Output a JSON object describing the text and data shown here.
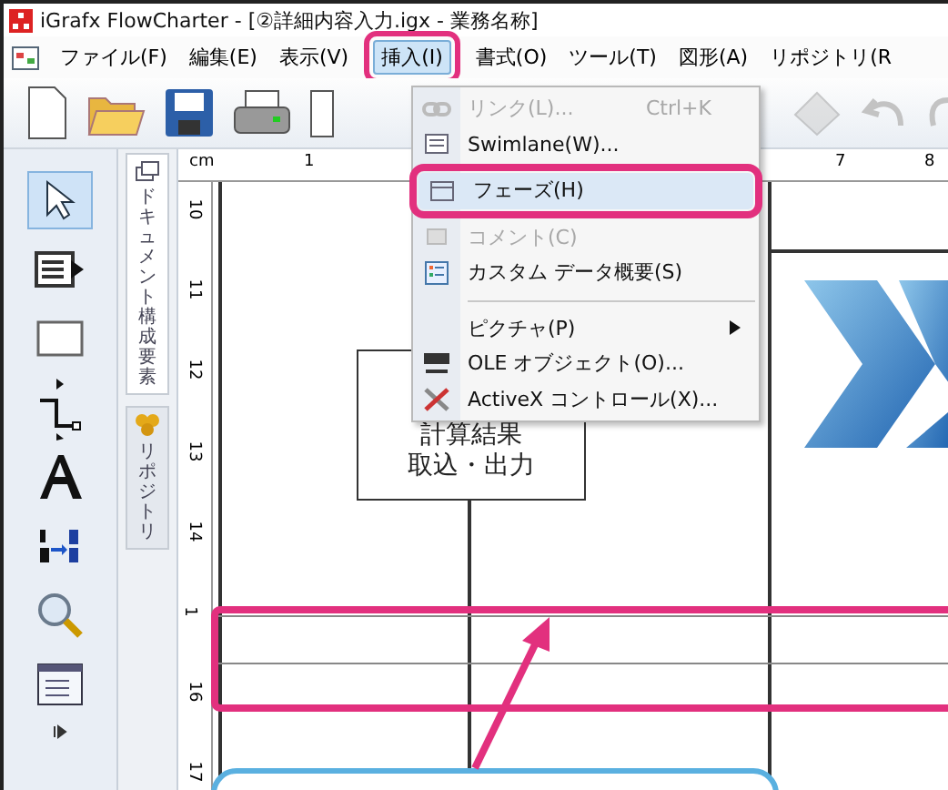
{
  "window": {
    "title": "iGrafx FlowCharter - [②詳細内容入力.igx - 業務名称]"
  },
  "menu_bar": [
    {
      "label": "ファイル(F)",
      "selected": false
    },
    {
      "label": "編集(E)",
      "selected": false
    },
    {
      "label": "表示(V)",
      "selected": false
    },
    {
      "label": "挿入(I)",
      "selected": true
    },
    {
      "label": "書式(O)",
      "selected": false
    },
    {
      "label": "ツール(T)",
      "selected": false
    },
    {
      "label": "図形(A)",
      "selected": false
    },
    {
      "label": "リポジトリ(R",
      "selected": false
    }
  ],
  "insert_menu": [
    {
      "kind": "item",
      "label": "リンク(L)...",
      "shortcut": "Ctrl+K",
      "disabled": true,
      "selected": false
    },
    {
      "kind": "item",
      "label": "Swimlane(W)...",
      "disabled": false,
      "selected": false
    },
    {
      "kind": "item",
      "label": "フェーズ(H)",
      "disabled": false,
      "selected": true
    },
    {
      "kind": "item",
      "label": "コメント(C)",
      "disabled": true,
      "selected": false
    },
    {
      "kind": "item",
      "label": "カスタム データ概要(S)",
      "disabled": false,
      "selected": false
    },
    {
      "kind": "separator"
    },
    {
      "kind": "submenu",
      "label": "ピクチャ(P)",
      "disabled": false,
      "selected": false
    },
    {
      "kind": "item",
      "label": "OLE オブジェクト(O)...",
      "disabled": false,
      "selected": false
    },
    {
      "kind": "item",
      "label": "ActiveX コントロール(X)...",
      "disabled": false,
      "selected": false
    }
  ],
  "toolbox": [
    {
      "kind": "pointer",
      "selected": true
    },
    {
      "kind": "shape-text",
      "selected": false
    },
    {
      "kind": "rectangle",
      "selected": false
    },
    {
      "kind": "connector",
      "selected": false
    },
    {
      "kind": "text",
      "selected": false
    },
    {
      "kind": "numbering",
      "selected": false
    },
    {
      "kind": "zoom",
      "selected": false
    },
    {
      "kind": "window",
      "selected": false
    }
  ],
  "side_tabs": [
    {
      "label": "ドキュメント構成要素",
      "selected": true
    },
    {
      "label": "リポジトリ",
      "selected": false
    }
  ],
  "ruler": {
    "unit": "cm",
    "top_marks": [
      "1",
      "7",
      "8"
    ],
    "left_marks": [
      "10",
      "11",
      "12",
      "13",
      "14",
      "1",
      "16",
      "17"
    ]
  },
  "canvas": {
    "shape_text": [
      "計算結果",
      "取込・出力"
    ]
  }
}
